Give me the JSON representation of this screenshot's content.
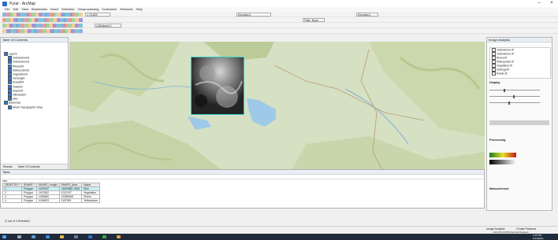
{
  "window": {
    "title": "Pyrat - ArcMap"
  },
  "menu": [
    "File",
    "Edit",
    "View",
    "Bookmarks",
    "Insert",
    "Selection",
    "Geoprocessing",
    "Customize",
    "Windows",
    "Help"
  ],
  "toolbar": {
    "scale_value": "1:78,829",
    "layer_combo": "Elevation1",
    "layer_combo_2": "LibDataset 1",
    "filter_combo": "Filter: None",
    "snap_combo": "Elevation1"
  },
  "toc": {
    "title": "Table Of Contents",
    "items": [
      {
        "label": "Layers",
        "depth": 0,
        "checked": true
      },
      {
        "label": "Yellowstone8",
        "depth": 1,
        "checked": true
      },
      {
        "label": "Yellowstone9",
        "depth": 1,
        "checked": true
      },
      {
        "label": "Rivers09",
        "depth": 1,
        "checked": true
      },
      {
        "label": "Waterpoints9",
        "depth": 1,
        "checked": true
      },
      {
        "label": "Vegetation9",
        "depth": 1,
        "checked": true
      },
      {
        "label": "Geology9",
        "depth": 1,
        "checked": true
      },
      {
        "label": "Roads09",
        "depth": 1,
        "checked": true
      },
      {
        "label": "Trails09",
        "depth": 1,
        "checked": true
      },
      {
        "label": "Slope09",
        "depth": 1,
        "checked": true
      },
      {
        "label": "Hillshade9",
        "depth": 1,
        "checked": true
      },
      {
        "label": "elev",
        "depth": 1,
        "checked": true
      },
      {
        "label": "Basemap",
        "depth": 0,
        "checked": true
      },
      {
        "label": "World Topographic Map",
        "depth": 1,
        "checked": true
      }
    ],
    "tabs": [
      "Results",
      "Table Of Contents"
    ]
  },
  "table": {
    "title": "Table",
    "subtitle": "elev",
    "columns": [
      "OBJECTID *",
      "SHAPE *",
      "SHAPE_Length",
      "SHAPE_Area",
      "Name"
    ],
    "rows": [
      [
        "1",
        "Polygon",
        "1487842",
        "14826881.3345",
        "Elev"
      ],
      [
        "2",
        "Polygon",
        "1407852",
        "1012197",
        "Vegetation"
      ],
      [
        "3",
        "Polygon",
        "1382880",
        "13285548",
        "Rivers"
      ],
      [
        "4",
        "Polygon",
        "1045633",
        "1157891",
        "Yellowstone"
      ]
    ],
    "footer": "(1 out of 4 Selected)",
    "footer_tab": "elev"
  },
  "image_analysis": {
    "title": "Image Analysis",
    "layers": [
      "Yellowstone.tif",
      "Yellowstone.tif",
      "Rivers.tif",
      "Waterpoints.tif",
      "Vegetation.tif",
      "Geology.tif",
      "Roads.tif"
    ],
    "display_label": "Display",
    "processing_label": "Processing",
    "measurement_label": "Measurement",
    "tabs": [
      "Image Analysis",
      "Create Features"
    ]
  },
  "status": {
    "coords": "-110.333  44.593 Decimal Degrees",
    "time": "2:15 PM",
    "date": "3/14/2023"
  },
  "colors": {
    "raster_border": "#33c9c9",
    "selected_row": "#c9f0f5",
    "taskbar": "#1f2a3a"
  }
}
